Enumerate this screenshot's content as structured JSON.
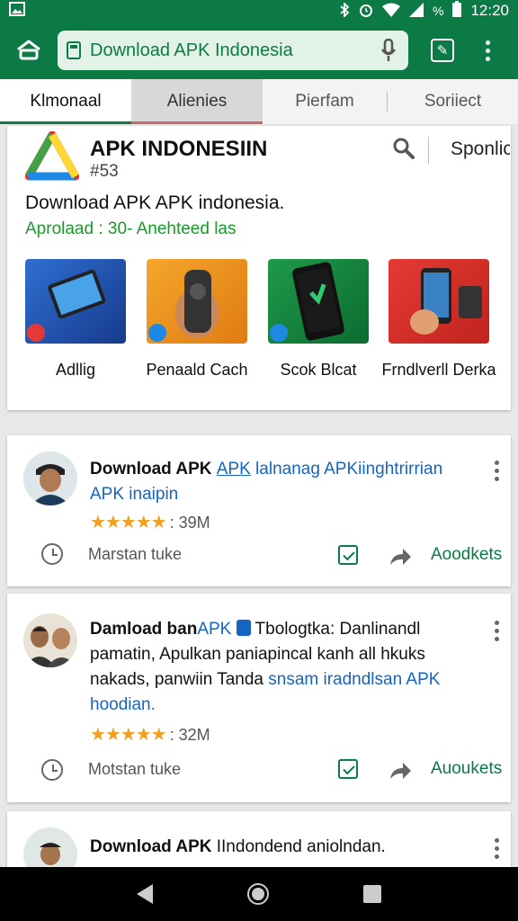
{
  "status_bar": {
    "time": "12:20",
    "battery_label": "%"
  },
  "browser": {
    "url_text": "Download APK Indonesia"
  },
  "tabs": [
    {
      "label": "Klmonaal"
    },
    {
      "label": "Alienies"
    },
    {
      "label": "Pierfam"
    },
    {
      "label": "Soriiect"
    }
  ],
  "app": {
    "title": "APK INDONESIIN",
    "code": "#53",
    "sponsor": "Sponlic",
    "description": "Download APK APK indonesia.",
    "meta": "Aprolaad : 30- Anehteed las",
    "thumbnails": [
      {
        "label": "Adllig"
      },
      {
        "label": "Penaald Cach"
      },
      {
        "label": "Scok Blcat"
      },
      {
        "label": "Frndlverll Derka"
      }
    ]
  },
  "posts": [
    {
      "title_bold": "Download APK ",
      "title_under": "APK",
      "title_link": " lalnanag APKiinghtrirrian APK inaipin",
      "rating_stars": "★★★★★",
      "rating": 4.5,
      "count": ": 39M",
      "footer": "Marstan tuke",
      "action": "Aoodkets"
    },
    {
      "title_bold": "Damload ban",
      "title_apk": "APK",
      "title_rest": " Tbologtka: Danlinandl pamatin, Apulkan paniapincal kanh all hkuks nakads, panwiin Tanda ",
      "title_link": "snsam iradndlsan APK hoodian.",
      "rating_stars": "★★★★★",
      "rating": 4.5,
      "count": ": 32M",
      "footer": "Motstan tuke",
      "action": "Auoukets"
    },
    {
      "title_bold": "Download APK ",
      "title_rest": "IIndondend aniolndan."
    }
  ],
  "colors": {
    "brand_green": "#0b7a45",
    "link_blue": "#1565c0",
    "star": "#f0a020"
  }
}
